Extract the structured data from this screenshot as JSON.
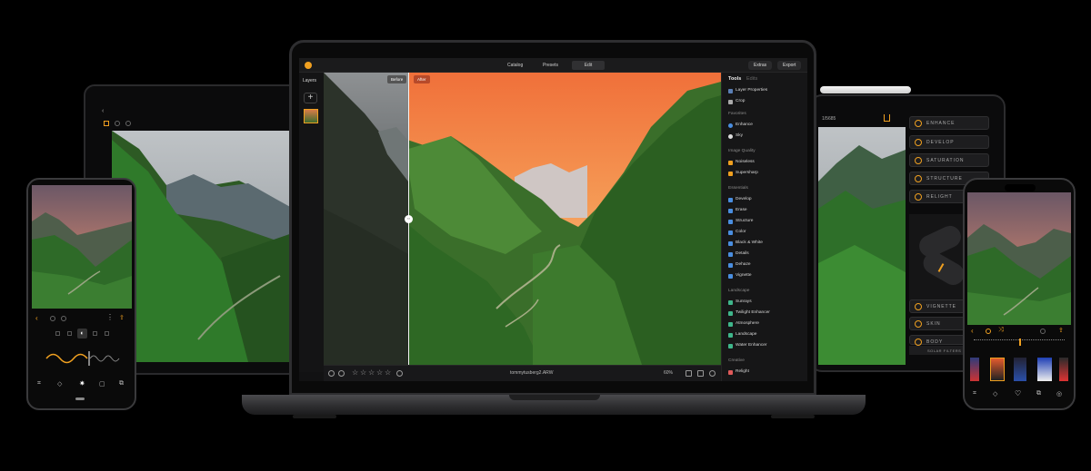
{
  "macbook": {
    "topbar": {
      "tabs": [
        {
          "label": "Catalog",
          "icon": "catalog-icon"
        },
        {
          "label": "Presets",
          "icon": "presets-icon"
        },
        {
          "label": "Edit",
          "icon": "edit-icon"
        }
      ],
      "extras_label": "Extras",
      "export_label": "Export"
    },
    "layers": {
      "title": "Layers"
    },
    "canvas": {
      "before_label": "Before",
      "after_label": "After"
    },
    "bottombar": {
      "filename": "tommytusberg2.ARW",
      "zoom": "60%"
    },
    "tools": {
      "header": "Tools",
      "header_secondary": "Edits",
      "top_items": [
        "Layer Properties",
        "Crop"
      ],
      "sections": [
        {
          "title": "Favorites",
          "items": [
            "Enhance",
            "Sky"
          ]
        },
        {
          "title": "Image Quality",
          "items": [
            "Noiseless",
            "Supersharp"
          ]
        },
        {
          "title": "Essentials",
          "items": [
            "Develop",
            "Erase",
            "Structure",
            "Color",
            "Black & White",
            "Details",
            "Dehaze",
            "Vignette"
          ]
        },
        {
          "title": "Landscape",
          "items": [
            "Sunrays",
            "Twilight Enhancer",
            "Atmosphere",
            "Landscape",
            "Water Enhancer"
          ]
        },
        {
          "title": "Creative",
          "items": [
            "Relight"
          ]
        }
      ]
    }
  },
  "tablet": {
    "filename": "1/5685",
    "tools": [
      "ENHANCE",
      "DEVELOP",
      "SATURATION",
      "STRUCTURE",
      "RELIGHT",
      "VIGNETTE",
      "SKIN",
      "BODY"
    ],
    "filters_label": "SOLAR FILTERS"
  },
  "accent_color": "#f0a020"
}
